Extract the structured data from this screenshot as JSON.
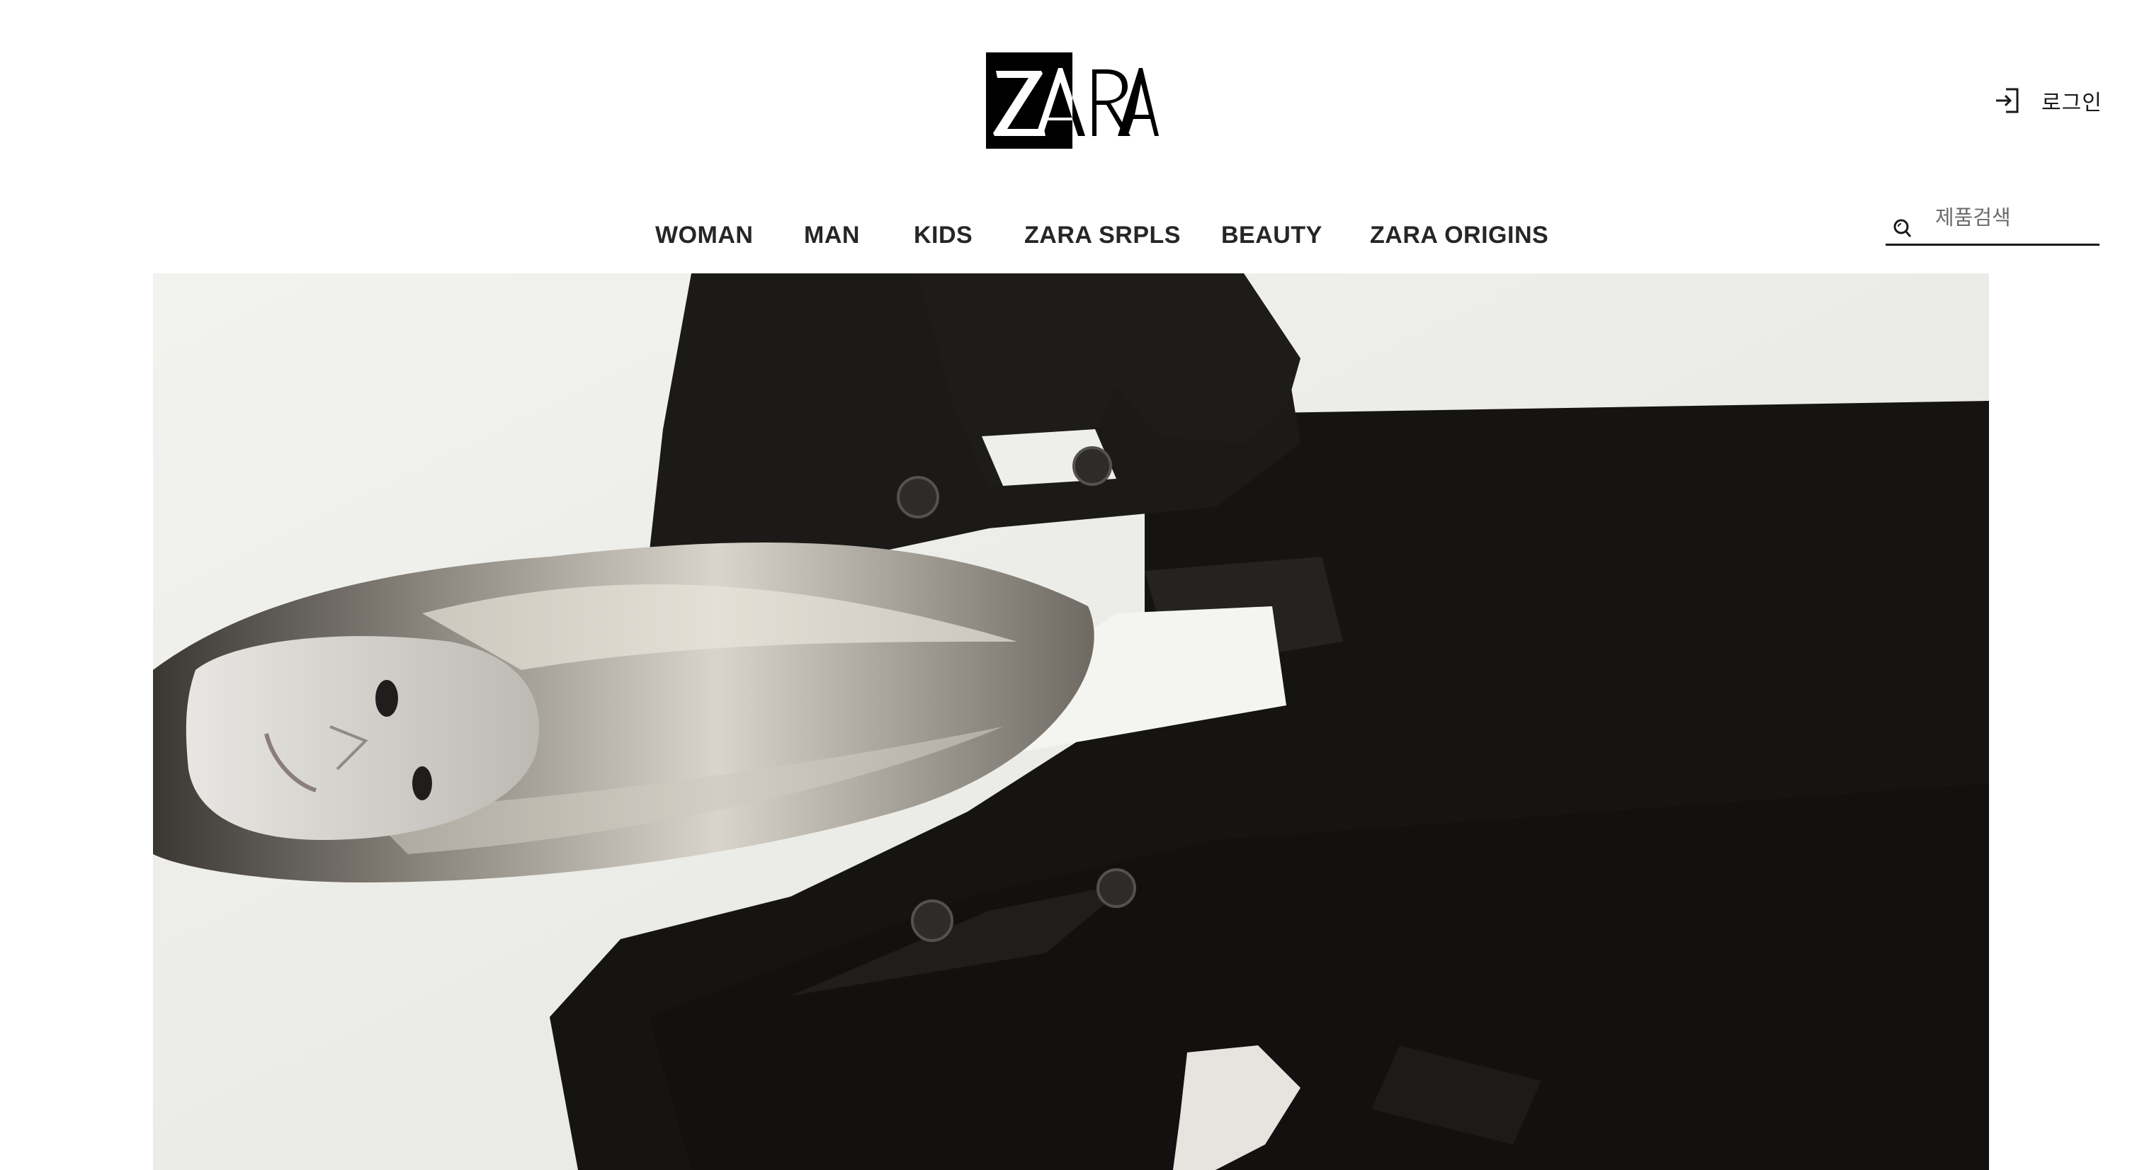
{
  "brand": {
    "logo_text": "ZARA"
  },
  "header": {
    "login_label": "로그인",
    "login_icon": "login-icon"
  },
  "nav": {
    "items": [
      {
        "label": "WOMAN"
      },
      {
        "label": "MAN"
      },
      {
        "label": "KIDS"
      },
      {
        "label": "ZARA SRPLS"
      },
      {
        "label": "BEAUTY"
      },
      {
        "label": "ZARA ORIGINS"
      }
    ]
  },
  "search": {
    "placeholder": "제품검색",
    "value": "",
    "icon": "search-icon"
  },
  "hero": {
    "image_description": "black-and-white campaign photo rotated 90°, model with long hair wearing a dark double-breasted coat"
  },
  "colors": {
    "text": "#1a1a1a",
    "background": "#ffffff",
    "logo": "#000000"
  }
}
